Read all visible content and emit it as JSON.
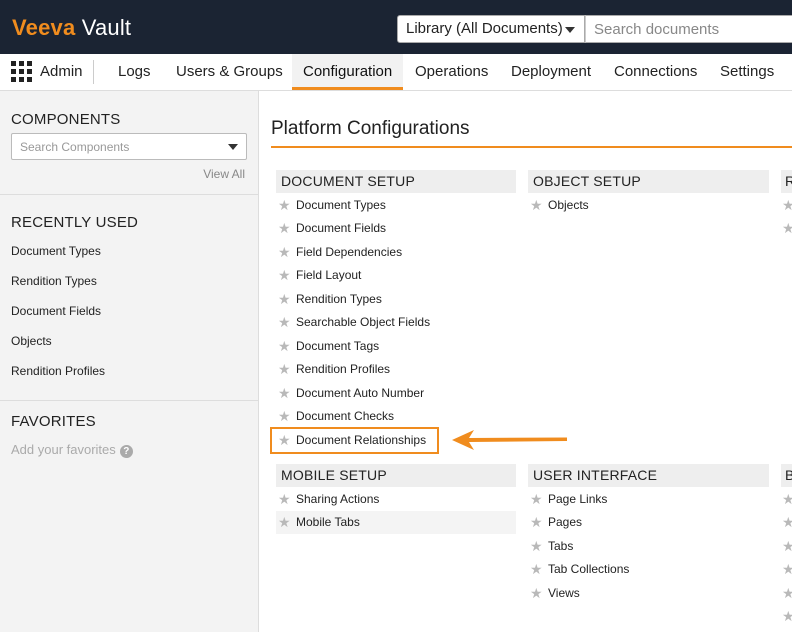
{
  "topbar": {
    "brand": "Veeva",
    "product": "Vault",
    "library_select": "Library (All Documents)",
    "search_placeholder": "Search documents"
  },
  "nav": {
    "admin_label": "Admin",
    "tabs": [
      "Logs",
      "Users & Groups",
      "Configuration",
      "Operations",
      "Deployment",
      "Connections",
      "Settings"
    ],
    "active_tab": "Configuration"
  },
  "sidebar": {
    "components_heading": "COMPONENTS",
    "search_placeholder": "Search Components",
    "view_all": "View All",
    "recent_heading": "RECENTLY USED",
    "recent_items": [
      "Document Types",
      "Rendition Types",
      "Document Fields",
      "Objects",
      "Rendition Profiles"
    ],
    "favorites_heading": "FAVORITES",
    "favorites_hint": "Add your favorites"
  },
  "main": {
    "title": "Platform Configurations",
    "sections": {
      "document_setup": {
        "heading": "DOCUMENT SETUP",
        "items": [
          "Document Types",
          "Document Fields",
          "Field Dependencies",
          "Field Layout",
          "Rendition Types",
          "Searchable Object Fields",
          "Document Tags",
          "Rendition Profiles",
          "Document Auto Number",
          "Document Checks",
          "Document Relationships"
        ]
      },
      "object_setup": {
        "heading": "OBJECT SETUP",
        "items": [
          "Objects"
        ]
      },
      "third_col_top": {
        "heading": "R"
      },
      "mobile_setup": {
        "heading": "MOBILE SETUP",
        "items": [
          "Sharing Actions",
          "Mobile Tabs"
        ]
      },
      "user_interface": {
        "heading": "USER INTERFACE",
        "items": [
          "Page Links",
          "Pages",
          "Tabs",
          "Tab Collections",
          "Views"
        ]
      },
      "third_col_bottom": {
        "heading": "B"
      }
    },
    "highlighted_item": "Document Relationships"
  },
  "colors": {
    "accent": "#f08c1e",
    "topbar_bg": "#1b2433",
    "sidebar_bg": "#f3f3f3",
    "section_header_bg": "#eeeeee",
    "star": "#b9b9b9"
  },
  "icons": [
    "grid-icon",
    "star-icon",
    "help-icon",
    "chevron-down-icon",
    "arrow-left-icon"
  ]
}
